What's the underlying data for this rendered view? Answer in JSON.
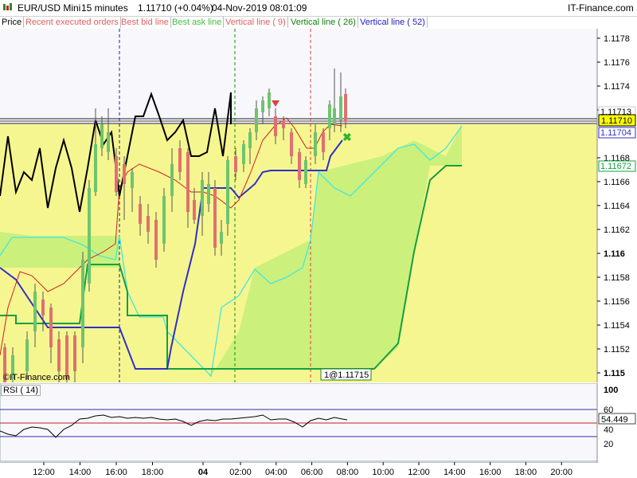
{
  "header": {
    "instrument": "EUR/USD Mini",
    "timeframe": "15 minutes",
    "price_change": "1.11710 (+0.04%)",
    "datetime": "04-Nov-2019 08:01:09",
    "brand": "IT-Finance.com"
  },
  "legend": {
    "price": "Price",
    "recent_executed": "Recent executed orders",
    "best_bid": "Best bid line",
    "best_ask": "Best ask line",
    "vline_9": "Vertical line ( 9)",
    "vline_26": "Vertical line ( 26)",
    "vline_52": "Vertical line ( 52)"
  },
  "price_axis": {
    "ticks": [
      "1.1178",
      "1.1176",
      "1.1174",
      "1.1172",
      "1.117",
      "1.1168",
      "1.1166",
      "1.1164",
      "1.1162",
      "1.116",
      "1.1158",
      "1.1156",
      "1.1154",
      "1.1152",
      "1.115"
    ],
    "bold_ticks": [
      "1.116",
      "1.115"
    ],
    "current_label": "1.11710",
    "label_faint": "1.11713",
    "label_blue": "1.11704",
    "label_teal": "1.11672"
  },
  "watermark": "©IT-Finance.com",
  "order_label": "1@1.11715",
  "rsi": {
    "label": "RSI ( 14)",
    "ticks": [
      "100",
      "60",
      "40",
      "20"
    ],
    "value_label": "54.449"
  },
  "time_axis": {
    "labels": [
      "12:00",
      "14:00",
      "16:00",
      "18:00",
      "04",
      "02:00",
      "04:00",
      "06:00",
      "08:00",
      "10:00",
      "12:00",
      "14:00",
      "16:00",
      "18:00",
      "20:00"
    ]
  },
  "colors": {
    "cloud_yellow": "#f5f58a",
    "cloud_green": "#c8f07a",
    "bull_candle": "#6ec46e",
    "bear_candle": "#e07070",
    "tenkan": "#d02020",
    "kijun": "#3030c8",
    "chikou": "#000000",
    "span_a": "#40e8e0",
    "span_b": "#10a040",
    "order_line": "#2060a0"
  }
}
